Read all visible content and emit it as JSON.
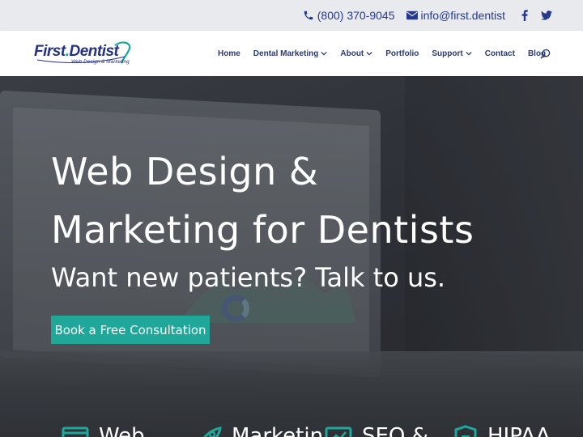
{
  "topbar": {
    "phone": "(800) 370-9045",
    "email": "info@first.dentist",
    "phone_icon": "phone-icon",
    "email_icon": "envelope-icon",
    "social": [
      "facebook-icon",
      "twitter-icon"
    ]
  },
  "logo": {
    "main_first": "First",
    "main_dot": ".",
    "main_second": "Dentist",
    "sub": "Web Design & Marketing"
  },
  "nav": {
    "items": [
      {
        "label": "Home",
        "dropdown": false
      },
      {
        "label": "Dental Marketing",
        "dropdown": true
      },
      {
        "label": "About",
        "dropdown": true
      },
      {
        "label": "Portfolio",
        "dropdown": false
      },
      {
        "label": "Support",
        "dropdown": true
      },
      {
        "label": "Contact",
        "dropdown": false
      },
      {
        "label": "Blog",
        "dropdown": false
      }
    ]
  },
  "hero": {
    "title_line1": "Web Design &",
    "title_line2": "Marketing for Dentists",
    "subtitle": "Want new patients? Talk to us.",
    "cta_label": "Book a Free Consultation"
  },
  "features": [
    {
      "label": "Web",
      "icon": "browser-window-icon"
    },
    {
      "label": "Marketin",
      "icon": "rocket-icon"
    },
    {
      "label": "SEO &",
      "icon": "monitor-chart-icon"
    },
    {
      "label": "HIPAA",
      "icon": "shield-lock-icon"
    }
  ],
  "colors": {
    "brand_navy": "#243a8c",
    "accent_teal": "#1fa89a",
    "topbar_bg": "#e8eaee"
  }
}
